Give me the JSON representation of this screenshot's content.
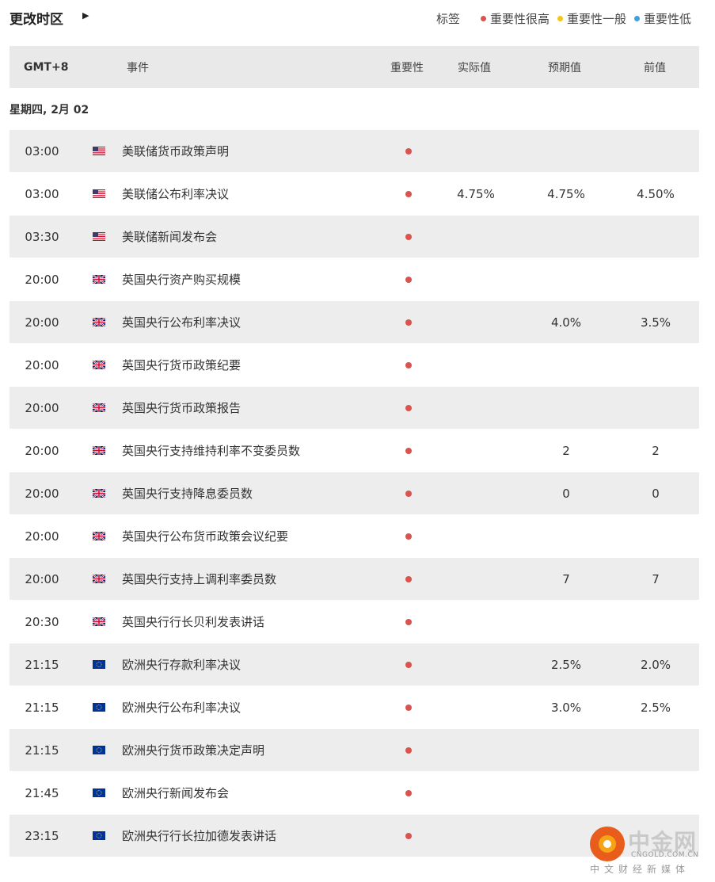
{
  "header": {
    "timezone_label": "更改时区",
    "arrow_glyph": "▶",
    "legend_title": "标签",
    "legend": [
      {
        "label": "重要性很高",
        "color": "#d9534f"
      },
      {
        "label": "重要性一般",
        "color": "#f5c518"
      },
      {
        "label": "重要性低",
        "color": "#3aa3e3"
      }
    ]
  },
  "table": {
    "columns": {
      "gmt": "GMT+8",
      "event": "事件",
      "importance": "重要性",
      "actual": "实际值",
      "forecast": "预期值",
      "previous": "前值"
    },
    "date": "星期四, 2月 02",
    "rows": [
      {
        "time": "03:00",
        "flag": "us-flag-icon",
        "event": "美联储货币政策声明",
        "importance_color": "#d9534f",
        "actual": "",
        "forecast": "",
        "previous": ""
      },
      {
        "time": "03:00",
        "flag": "us-flag-icon",
        "event": "美联储公布利率决议",
        "importance_color": "#d9534f",
        "actual": "4.75%",
        "forecast": "4.75%",
        "previous": "4.50%"
      },
      {
        "time": "03:30",
        "flag": "us-flag-icon",
        "event": "美联储新闻发布会",
        "importance_color": "#d9534f",
        "actual": "",
        "forecast": "",
        "previous": ""
      },
      {
        "time": "20:00",
        "flag": "uk-flag-icon",
        "event": "英国央行资产购买规模",
        "importance_color": "#d9534f",
        "actual": "",
        "forecast": "",
        "previous": ""
      },
      {
        "time": "20:00",
        "flag": "uk-flag-icon",
        "event": "英国央行公布利率决议",
        "importance_color": "#d9534f",
        "actual": "",
        "forecast": "4.0%",
        "previous": "3.5%"
      },
      {
        "time": "20:00",
        "flag": "uk-flag-icon",
        "event": "英国央行货币政策纪要",
        "importance_color": "#d9534f",
        "actual": "",
        "forecast": "",
        "previous": ""
      },
      {
        "time": "20:00",
        "flag": "uk-flag-icon",
        "event": "英国央行货币政策报告",
        "importance_color": "#d9534f",
        "actual": "",
        "forecast": "",
        "previous": ""
      },
      {
        "time": "20:00",
        "flag": "uk-flag-icon",
        "event": "英国央行支持维持利率不变委员数",
        "importance_color": "#d9534f",
        "actual": "",
        "forecast": "2",
        "previous": "2"
      },
      {
        "time": "20:00",
        "flag": "uk-flag-icon",
        "event": "英国央行支持降息委员数",
        "importance_color": "#d9534f",
        "actual": "",
        "forecast": "0",
        "previous": "0"
      },
      {
        "time": "20:00",
        "flag": "uk-flag-icon",
        "event": "英国央行公布货币政策会议纪要",
        "importance_color": "#d9534f",
        "actual": "",
        "forecast": "",
        "previous": ""
      },
      {
        "time": "20:00",
        "flag": "uk-flag-icon",
        "event": "英国央行支持上调利率委员数",
        "importance_color": "#d9534f",
        "actual": "",
        "forecast": "7",
        "previous": "7"
      },
      {
        "time": "20:30",
        "flag": "uk-flag-icon",
        "event": "英国央行行长贝利发表讲话",
        "importance_color": "#d9534f",
        "actual": "",
        "forecast": "",
        "previous": ""
      },
      {
        "time": "21:15",
        "flag": "eu-flag-icon",
        "event": "欧洲央行存款利率决议",
        "importance_color": "#d9534f",
        "actual": "",
        "forecast": "2.5%",
        "previous": "2.0%"
      },
      {
        "time": "21:15",
        "flag": "eu-flag-icon",
        "event": "欧洲央行公布利率决议",
        "importance_color": "#d9534f",
        "actual": "",
        "forecast": "3.0%",
        "previous": "2.5%"
      },
      {
        "time": "21:15",
        "flag": "eu-flag-icon",
        "event": "欧洲央行货币政策决定声明",
        "importance_color": "#d9534f",
        "actual": "",
        "forecast": "",
        "previous": ""
      },
      {
        "time": "21:45",
        "flag": "eu-flag-icon",
        "event": "欧洲央行新闻发布会",
        "importance_color": "#d9534f",
        "actual": "",
        "forecast": "",
        "previous": ""
      },
      {
        "time": "23:15",
        "flag": "eu-flag-icon",
        "event": "欧洲央行行长拉加德发表讲话",
        "importance_color": "#d9534f",
        "actual": "",
        "forecast": "",
        "previous": ""
      }
    ]
  },
  "watermark": {
    "brand_cn": "中金网",
    "brand_en": "CNGOLD.COM.CN",
    "tagline": "中文财经新媒体"
  }
}
